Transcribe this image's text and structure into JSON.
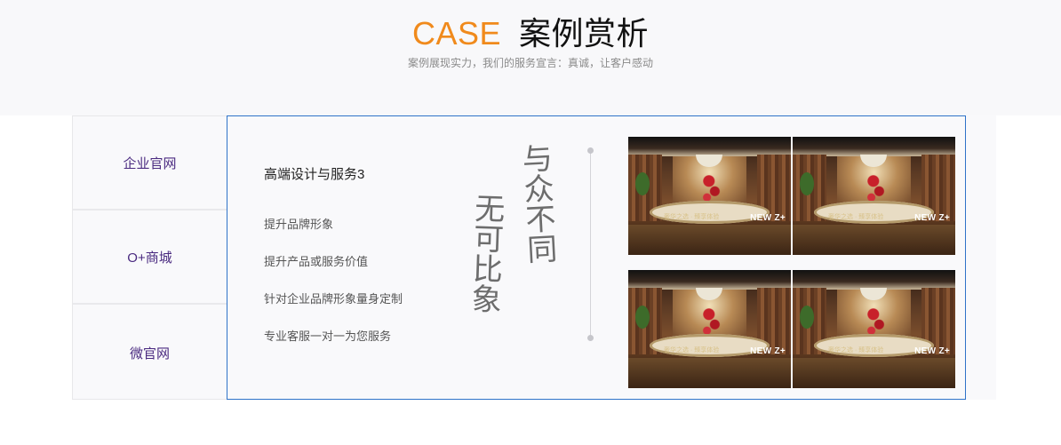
{
  "header": {
    "title_en": "CASE",
    "title_cn": "案例赏析",
    "subtitle": "案例展现实力，我们的服务宣言：真诚，让客户感动"
  },
  "tabs": [
    {
      "label": "企业官网"
    },
    {
      "label": "O+商城"
    },
    {
      "label": "微官网"
    }
  ],
  "panel": {
    "heading": "高端设计与服务3",
    "features": [
      "提升品牌形象",
      "提升产品或服务价值",
      "针对企业品牌形象量身定制",
      "专业客服一对一为您服务"
    ],
    "calligraphy": {
      "column_right": "与众不同",
      "column_left": "无可比象"
    }
  },
  "gallery": {
    "tiles": [
      {
        "badge": "NEW Z+",
        "caption": "奢华之选 · 臻享体验"
      },
      {
        "badge": "NEW Z+",
        "caption": "奢华之选 · 臻享体验"
      },
      {
        "badge": "NEW Z+",
        "caption": "奢华之选 · 臻享体验"
      },
      {
        "badge": "NEW Z+",
        "caption": "奢华之选 · 臻享体验"
      }
    ]
  },
  "colors": {
    "accent": "#f08a1c",
    "tab_text": "#4a2a80",
    "panel_border": "#2f73c9"
  }
}
